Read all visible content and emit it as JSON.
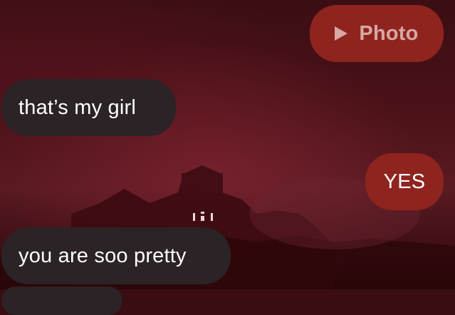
{
  "colors": {
    "incoming_bubble": "#2b2325",
    "outgoing_bubble": "#8f241f",
    "photo_label": "#d8a6a3",
    "text": "#ffffff"
  },
  "messages": [
    {
      "direction": "outgoing",
      "kind": "photo",
      "icon": "play-icon",
      "text": "Photo"
    },
    {
      "direction": "incoming",
      "kind": "text",
      "text": "that’s my girl"
    },
    {
      "direction": "outgoing",
      "kind": "text",
      "text": "YES"
    },
    {
      "direction": "incoming",
      "kind": "text",
      "text": "you are soo pretty"
    }
  ]
}
